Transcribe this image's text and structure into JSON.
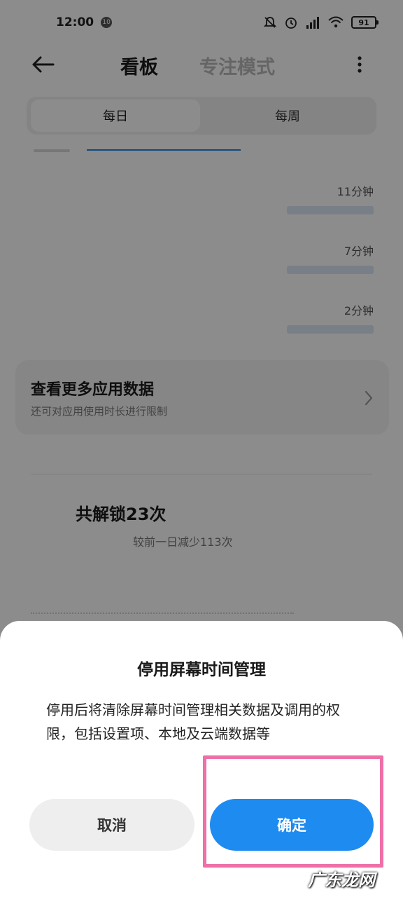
{
  "status_bar": {
    "time": "12:00",
    "notification_badge": "10",
    "battery": "91"
  },
  "toolbar": {
    "tabs": [
      {
        "label": "看板",
        "active": true
      },
      {
        "label": "专注模式",
        "active": false
      }
    ]
  },
  "segment": {
    "options": [
      {
        "label": "每日",
        "selected": true
      },
      {
        "label": "每周",
        "selected": false
      }
    ]
  },
  "app_usage": [
    {
      "duration": "11分钟"
    },
    {
      "duration": "7分钟"
    },
    {
      "duration": "2分钟"
    }
  ],
  "more_data": {
    "title": "查看更多应用数据",
    "subtitle": "还可对应用使用时长进行限制"
  },
  "unlocks": {
    "title": "共解锁23次",
    "subtitle": "较前一日减少113次"
  },
  "dialog": {
    "title": "停用屏幕时间管理",
    "message": "停用后将清除屏幕时间管理相关数据及调用的权限，包括设置项、本地及云端数据等",
    "cancel_label": "取消",
    "confirm_label": "确定"
  },
  "watermark": "广东龙网",
  "colors": {
    "accent": "#1e8bf0",
    "highlight": "#ef6fa8",
    "scrim": "#000000"
  }
}
